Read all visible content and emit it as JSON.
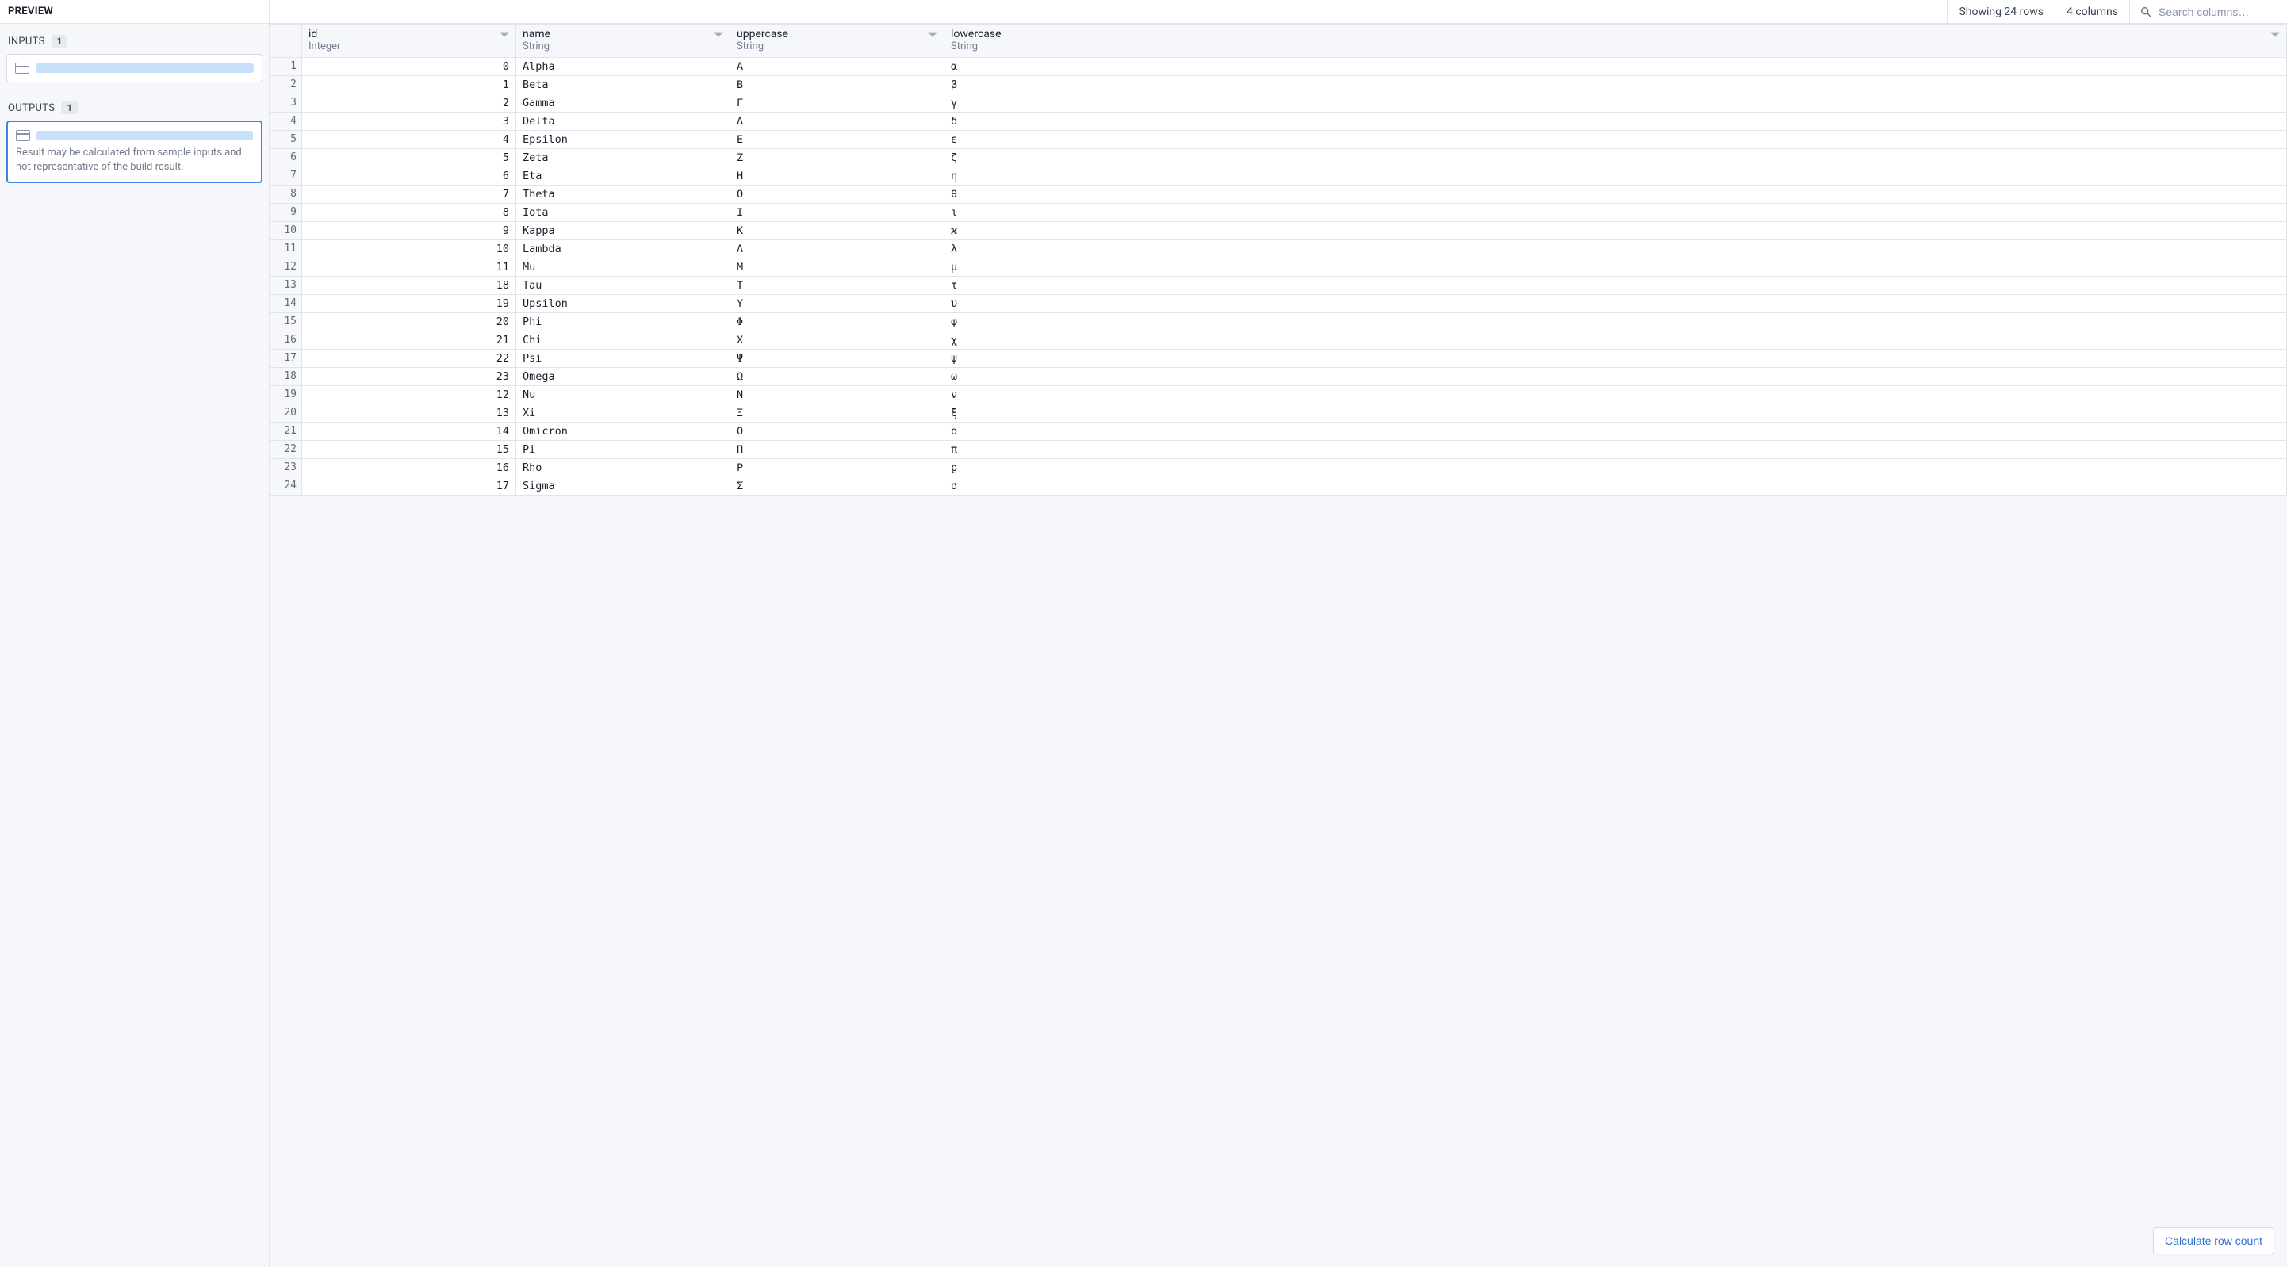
{
  "sidebar": {
    "preview_label": "PREVIEW",
    "inputs": {
      "label": "INPUTS",
      "count": "1",
      "datasets": [
        {
          "icon": "table-icon"
        }
      ]
    },
    "outputs": {
      "label": "OUTPUTS",
      "count": "1",
      "datasets": [
        {
          "icon": "table-icon",
          "selected": true
        }
      ],
      "hint": "Result may be calculated from sample inputs and not representative of the build result."
    }
  },
  "toolbar": {
    "rows_label": "Showing 24 rows",
    "cols_label": "4 columns",
    "search_placeholder": "Search columns…"
  },
  "table": {
    "columns": [
      {
        "name": "id",
        "type": "Integer",
        "align": "num"
      },
      {
        "name": "name",
        "type": "String",
        "align": "txt"
      },
      {
        "name": "uppercase",
        "type": "String",
        "align": "txt"
      },
      {
        "name": "lowercase",
        "type": "String",
        "align": "txt"
      }
    ],
    "rows": [
      {
        "id": 0,
        "name": "Alpha",
        "uppercase": "Α",
        "lowercase": "α"
      },
      {
        "id": 1,
        "name": "Beta",
        "uppercase": "Β",
        "lowercase": "β"
      },
      {
        "id": 2,
        "name": "Gamma",
        "uppercase": "Γ",
        "lowercase": "γ"
      },
      {
        "id": 3,
        "name": "Delta",
        "uppercase": "Δ",
        "lowercase": "δ"
      },
      {
        "id": 4,
        "name": "Epsilon",
        "uppercase": "Ε",
        "lowercase": "ε"
      },
      {
        "id": 5,
        "name": "Zeta",
        "uppercase": "Ζ",
        "lowercase": "ζ"
      },
      {
        "id": 6,
        "name": "Eta",
        "uppercase": "Η",
        "lowercase": "η"
      },
      {
        "id": 7,
        "name": "Theta",
        "uppercase": "Θ",
        "lowercase": "θ"
      },
      {
        "id": 8,
        "name": "Iota",
        "uppercase": "Ι",
        "lowercase": "ι"
      },
      {
        "id": 9,
        "name": "Kappa",
        "uppercase": "Κ",
        "lowercase": "ϰ"
      },
      {
        "id": 10,
        "name": "Lambda",
        "uppercase": "Λ",
        "lowercase": "λ"
      },
      {
        "id": 11,
        "name": "Mu",
        "uppercase": "Μ",
        "lowercase": "μ"
      },
      {
        "id": 18,
        "name": "Tau",
        "uppercase": "Τ",
        "lowercase": "τ"
      },
      {
        "id": 19,
        "name": "Upsilon",
        "uppercase": "Υ",
        "lowercase": "υ"
      },
      {
        "id": 20,
        "name": "Phi",
        "uppercase": "Φ",
        "lowercase": "φ"
      },
      {
        "id": 21,
        "name": "Chi",
        "uppercase": "Χ",
        "lowercase": "χ"
      },
      {
        "id": 22,
        "name": "Psi",
        "uppercase": "Ψ",
        "lowercase": "ψ"
      },
      {
        "id": 23,
        "name": "Omega",
        "uppercase": "Ω",
        "lowercase": "ω"
      },
      {
        "id": 12,
        "name": "Nu",
        "uppercase": "Ν",
        "lowercase": "ν"
      },
      {
        "id": 13,
        "name": "Xi",
        "uppercase": "Ξ",
        "lowercase": "ξ"
      },
      {
        "id": 14,
        "name": "Omicron",
        "uppercase": "Ο",
        "lowercase": "ο"
      },
      {
        "id": 15,
        "name": "Pi",
        "uppercase": "Π",
        "lowercase": "π"
      },
      {
        "id": 16,
        "name": "Rho",
        "uppercase": "Ρ",
        "lowercase": "ϱ"
      },
      {
        "id": 17,
        "name": "Sigma",
        "uppercase": "Σ",
        "lowercase": "σ"
      }
    ]
  },
  "footer": {
    "calc_button": "Calculate row count"
  }
}
